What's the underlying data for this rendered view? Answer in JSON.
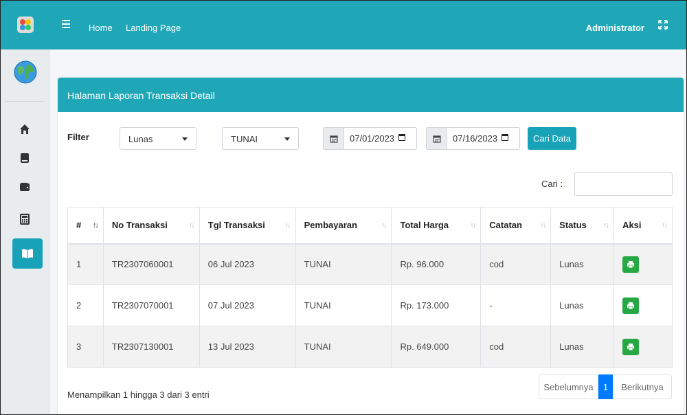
{
  "topbar": {
    "nav": [
      "Home",
      "Landing Page"
    ],
    "user": "Administrator"
  },
  "sidebar": {
    "icons": [
      "home-icon",
      "book-icon",
      "wallet-icon",
      "calculator-icon",
      "open-book-icon"
    ],
    "active_index": 4
  },
  "card": {
    "title": "Halaman Laporan Transaksi Detail",
    "filter_label": "Filter",
    "status_select": "Lunas",
    "payment_select": "TUNAI",
    "date_from": "07/01/2023",
    "date_to": "07/16/2023",
    "search_button": "Cari Data",
    "search_label": "Cari :"
  },
  "table": {
    "headers": [
      "#",
      "No Transaksi",
      "Tgl Transaksi",
      "Pembayaran",
      "Total Harga",
      "Catatan",
      "Status",
      "Aksi"
    ],
    "rows": [
      [
        "1",
        "TR2307060001",
        "06 Jul 2023",
        "TUNAI",
        "Rp. 96.000",
        "cod",
        "Lunas"
      ],
      [
        "2",
        "TR2307070001",
        "07 Jul 2023",
        "TUNAI",
        "Rp. 173.000",
        "-",
        "Lunas"
      ],
      [
        "3",
        "TR2307130001",
        "13 Jul 2023",
        "TUNAI",
        "Rp. 649.000",
        "cod",
        "Lunas"
      ]
    ]
  },
  "footer": {
    "info": "Menampilkan 1 hingga 3 dari 3 entri",
    "prev": "Sebelumnya",
    "page": "1",
    "next": "Berikutnya"
  },
  "colors": {
    "primary": "#1fa7b8",
    "info_button": "#17a2b8",
    "success": "#28a745",
    "page_active": "#007bff"
  }
}
